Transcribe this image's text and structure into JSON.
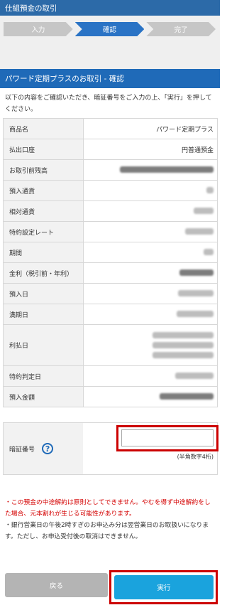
{
  "header": {
    "title": "仕組預金の取引"
  },
  "steps": [
    {
      "label": "入力"
    },
    {
      "label": "確認"
    },
    {
      "label": "完了"
    }
  ],
  "section": {
    "title": "パワード定期プラスのお取引 - 確認",
    "intro": "以下の内容をご確認いただき、暗証番号をご入力の上、「実行」を押してください。"
  },
  "details": {
    "product_label": "商品名",
    "product_value": "パワード定期プラス",
    "account_label": "払出口座",
    "account_value": "円普通預金",
    "balance_label": "お取引前残高",
    "deposit_currency_label": "預入通貨",
    "counter_currency_label": "相対通貨",
    "special_rate_label": "特約設定レート",
    "term_label": "期間",
    "interest_label": "金利（税引前・年利）",
    "deposit_date_label": "預入日",
    "maturity_date_label": "満期日",
    "interest_payment_label": "利払日",
    "special_judgement_label": "特約判定日",
    "deposit_amount_label": "預入金額"
  },
  "pin": {
    "label": "暗証番号",
    "hint": "(半角数字4桁)",
    "value": ""
  },
  "notes": {
    "note1": "・この預金の中途解約は原則としてできません。やむを得ず中途解約をした場合、元本割れが生じる可能性があります。",
    "note2": "・銀行営業日の午後2時すぎのお申込み分は翌営業日のお取扱いになります。ただし、お申込受付後の取消はできません。"
  },
  "buttons": {
    "back": "戻る",
    "execute": "実行"
  },
  "colors": {
    "header_bg": "#2c6aa8",
    "section_bg": "#1f6ab8",
    "active_step": "#2a73c5",
    "execute_button": "#1aa3dd",
    "highlight_border": "#cc0000",
    "warning_text": "#d40000"
  },
  "icons": {
    "help": "help-icon"
  }
}
